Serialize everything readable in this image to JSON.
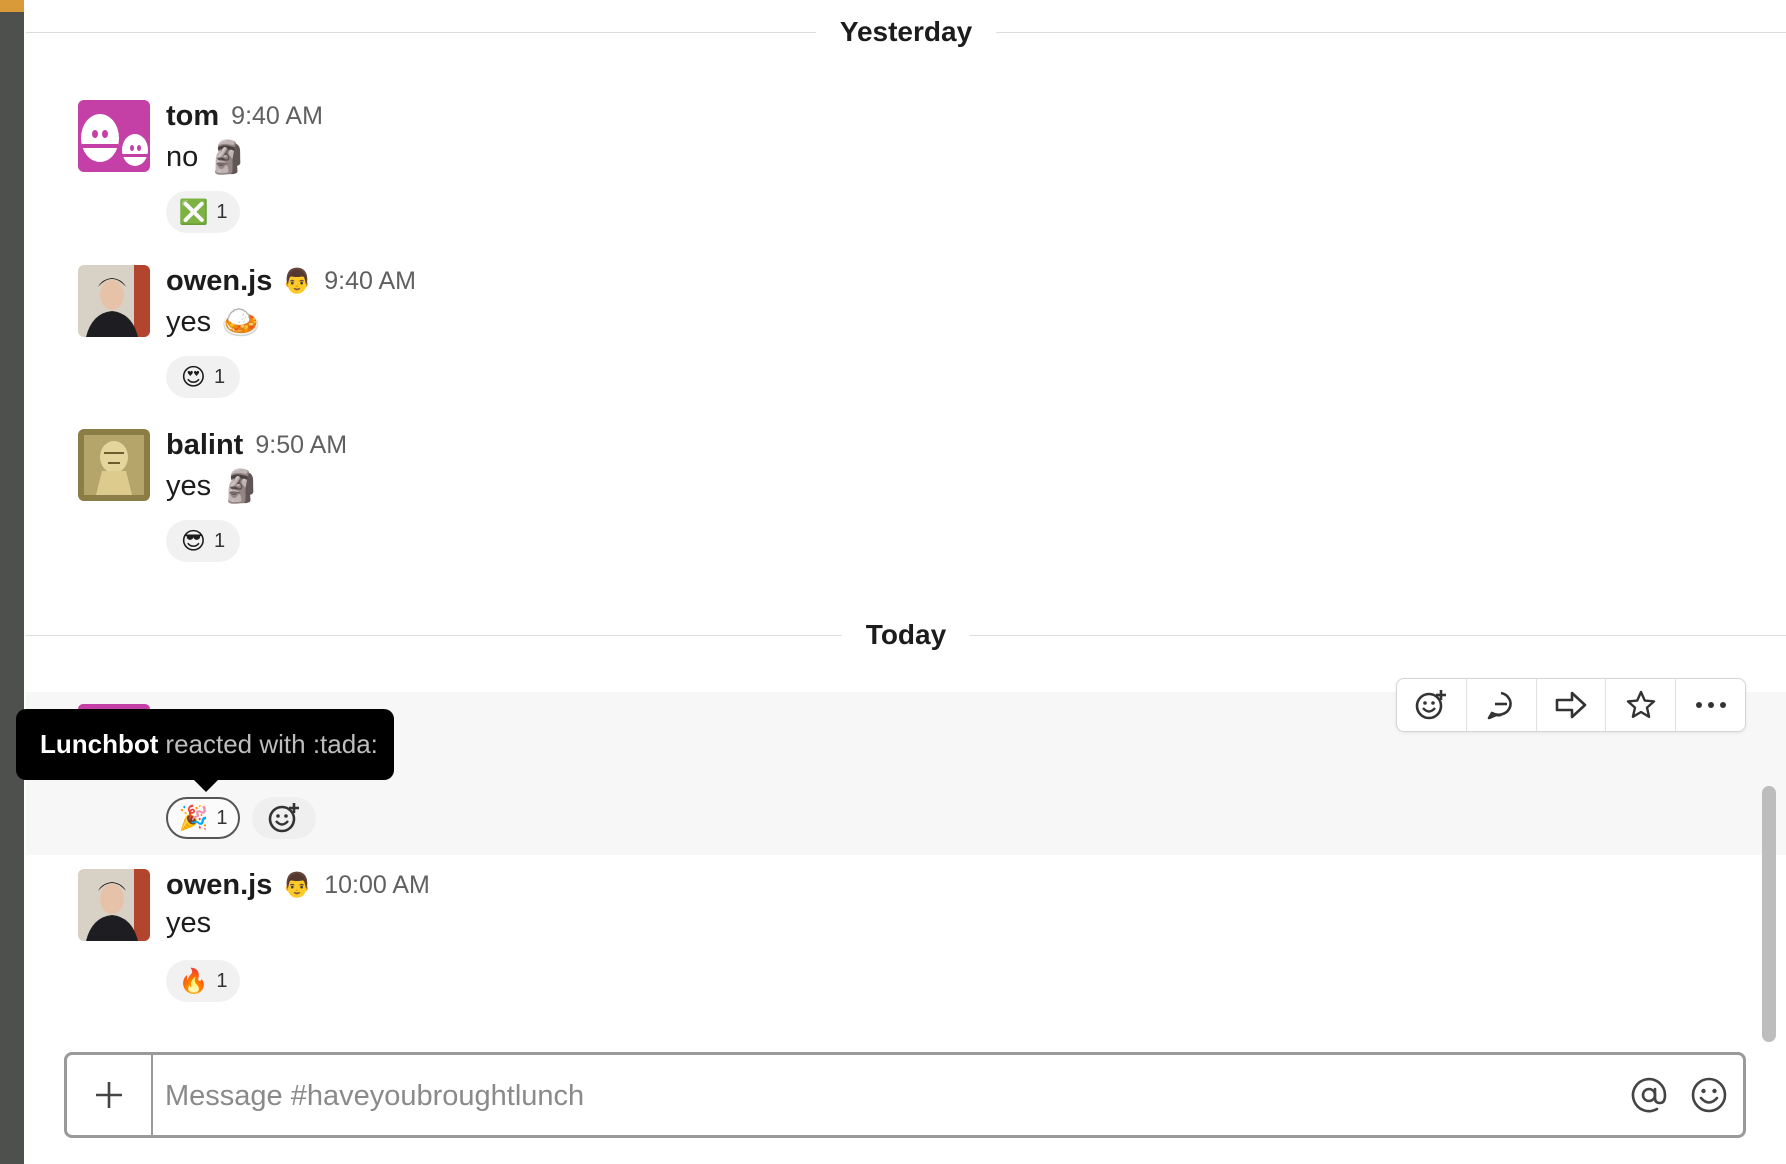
{
  "dividers": {
    "yesterday": "Yesterday",
    "today": "Today"
  },
  "messages": [
    {
      "author": "tom",
      "status_emoji": "",
      "time": "9:40 AM",
      "text": "no",
      "inline_emoji": "🗿",
      "reaction": {
        "emoji": "❎",
        "count": "1"
      }
    },
    {
      "author": "owen.js",
      "status_emoji": "👨",
      "time": "9:40 AM",
      "text": "yes",
      "inline_emoji": "🍛",
      "reaction": {
        "emoji": "😍",
        "count": "1"
      }
    },
    {
      "author": "balint",
      "status_emoji": "",
      "time": "9:50 AM",
      "text": "yes",
      "inline_emoji": "🗿",
      "reaction": {
        "emoji": "😎",
        "count": "1"
      }
    },
    {
      "reaction": {
        "emoji": "🎉",
        "count": "1"
      }
    },
    {
      "author": "owen.js",
      "status_emoji": "👨",
      "time": "10:00 AM",
      "text": "yes",
      "inline_emoji": "",
      "reaction": {
        "emoji": "🔥",
        "count": "1"
      }
    }
  ],
  "tooltip": {
    "who": "Lunchbot",
    "what": "reacted with :tada:"
  },
  "toolbar_icons": [
    "add-reaction-icon",
    "reply-thread-icon",
    "share-icon",
    "star-icon",
    "more-actions-icon"
  ],
  "composer": {
    "placeholder": "Message #haveyoubroughtlunch",
    "value": ""
  },
  "colors": {
    "left_rail": "#4d504d",
    "rail_accent": "#d99b3a",
    "tooltip_bg": "#000000",
    "active_reaction_border": "#555555"
  }
}
